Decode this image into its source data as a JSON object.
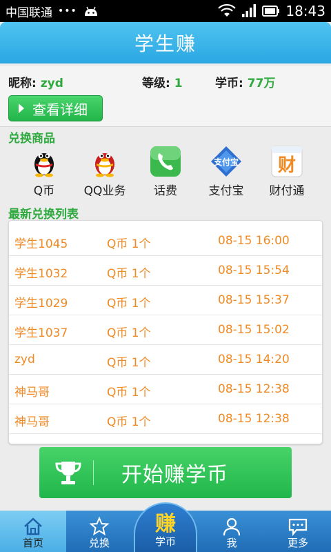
{
  "status_bar": {
    "carrier": "中国联通",
    "notification_dots": "•••",
    "time": "18:43"
  },
  "header": {
    "title": "学生赚"
  },
  "user": {
    "nickname_label": "昵称:",
    "nickname_value": "zyd",
    "level_label": "等级:",
    "level_value": "1",
    "coin_label": "学币:",
    "coin_value": "77万",
    "detail_button": "查看详细"
  },
  "exchange": {
    "section_title": "兑换商品",
    "items": [
      {
        "label": "Q币",
        "icon": "qq-penguin-icon"
      },
      {
        "label": "QQ业务",
        "icon": "qq-red-penguin-icon"
      },
      {
        "label": "话费",
        "icon": "phone-icon"
      },
      {
        "label": "支付宝",
        "icon": "alipay-icon"
      },
      {
        "label": "财付通",
        "icon": "tenpay-icon"
      }
    ]
  },
  "recent": {
    "section_title": "最新兑换列表",
    "rows": [
      {
        "user": "学生1045",
        "item": "Q币 1个",
        "time": "08-15 16:00"
      },
      {
        "user": "学生1032",
        "item": "Q币 1个",
        "time": "08-15 15:54"
      },
      {
        "user": "学生1029",
        "item": "Q币 1个",
        "time": "08-15 15:37"
      },
      {
        "user": "学生1037",
        "item": "Q币 1个",
        "time": "08-15 15:02"
      },
      {
        "user": "zyd",
        "item": "Q币 1个",
        "time": "08-15 14:20"
      },
      {
        "user": "神马哥",
        "item": "Q币 1个",
        "time": "08-15 12:38"
      },
      {
        "user": "神马哥",
        "item": "Q币 1个",
        "time": "08-15 12:38"
      }
    ]
  },
  "earn_button": {
    "label": "开始赚学币",
    "icon": "trophy-icon"
  },
  "nav": {
    "items": [
      {
        "label": "首页",
        "icon": "home-icon",
        "active": true
      },
      {
        "label": "兑换",
        "icon": "star-icon",
        "active": false
      },
      {
        "label": "学币",
        "icon": "earn-icon",
        "active": false
      },
      {
        "label": "我",
        "icon": "person-icon",
        "active": false
      },
      {
        "label": "更多",
        "icon": "more-chat-icon",
        "active": false
      }
    ],
    "earn_glyph": "赚"
  },
  "colors": {
    "accent_blue": "#2aa7e2",
    "green": "#2faa3f",
    "list_text": "#f08a24",
    "nav_blue": "#1f6db6"
  }
}
